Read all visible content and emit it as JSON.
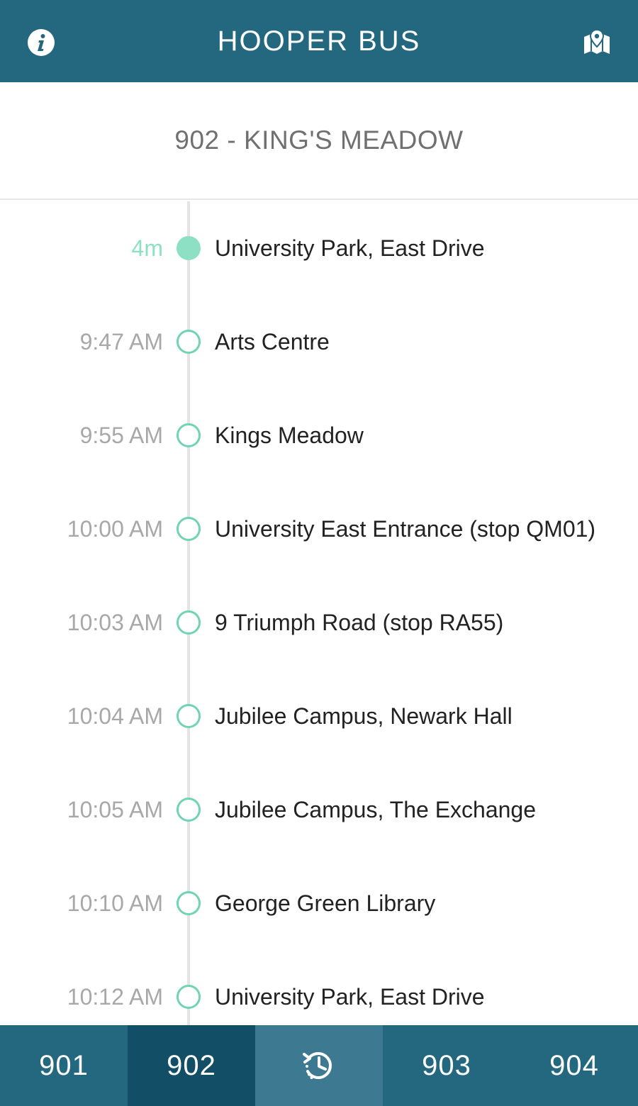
{
  "header": {
    "title": "HOOPER BUS",
    "left_icon": "info-icon",
    "right_icon": "map-icon"
  },
  "route": {
    "title": "902 - KING'S MEADOW"
  },
  "stops": [
    {
      "time": "4m",
      "name": "University Park, East Drive",
      "live": true
    },
    {
      "time": "9:47 AM",
      "name": "Arts Centre",
      "live": false
    },
    {
      "time": "9:55 AM",
      "name": "Kings Meadow",
      "live": false
    },
    {
      "time": "10:00 AM",
      "name": "University East Entrance (stop QM01)",
      "live": false
    },
    {
      "time": "10:03 AM",
      "name": "9 Triumph Road (stop RA55)",
      "live": false
    },
    {
      "time": "10:04 AM",
      "name": "Jubilee Campus, Newark Hall",
      "live": false
    },
    {
      "time": "10:05 AM",
      "name": "Jubilee Campus, The Exchange",
      "live": false
    },
    {
      "time": "10:10 AM",
      "name": "George Green Library",
      "live": false
    },
    {
      "time": "10:12 AM",
      "name": "University Park, East Drive",
      "live": false
    }
  ],
  "tabs": [
    {
      "label": "901",
      "active": false
    },
    {
      "label": "902",
      "active": true
    },
    {
      "label": "",
      "icon": "history-icon",
      "active": false
    },
    {
      "label": "903",
      "active": false
    },
    {
      "label": "904",
      "active": false
    }
  ],
  "colors": {
    "primary": "#246880",
    "tab_active": "#124e66",
    "tab_history": "#3d7a91",
    "accent": "#6ed4b4",
    "live": "#8de0c4"
  }
}
